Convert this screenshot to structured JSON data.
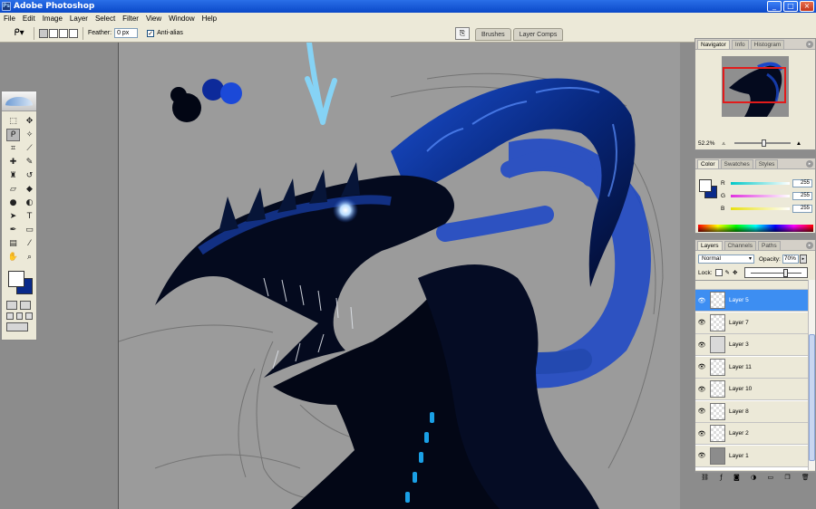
{
  "app": {
    "title": "Adobe Photoshop",
    "window_buttons": [
      "_",
      "□",
      "×"
    ]
  },
  "menu": [
    "File",
    "Edit",
    "Image",
    "Layer",
    "Select",
    "Filter",
    "View",
    "Window",
    "Help"
  ],
  "options": {
    "feather_label": "Feather:",
    "feather_value": "0 px",
    "antialias_label": "Anti-alias",
    "antialias_checked": "✓"
  },
  "palette_well": [
    "Brushes",
    "Layer Comps"
  ],
  "navigator": {
    "tabs": [
      "Navigator",
      "Info",
      "Histogram"
    ],
    "zoom": "52.2%"
  },
  "color": {
    "tabs": [
      "Color",
      "Swatches",
      "Styles"
    ],
    "sliders": [
      {
        "label": "R",
        "value": "255",
        "color": "#00c8c8"
      },
      {
        "label": "G",
        "value": "255",
        "color": "#e030e0"
      },
      {
        "label": "B",
        "value": "255",
        "color": "#e8e010"
      }
    ]
  },
  "layers": {
    "tabs": [
      "Layers",
      "Channels",
      "Paths"
    ],
    "blend_mode": "Normal",
    "opacity_label": "Opacity:",
    "opacity_value": "70%",
    "opacity_fraction": 0.7,
    "lock_label": "Lock:",
    "items": [
      {
        "name": "Layer 5",
        "active": true,
        "visible": true,
        "thumb": "transparent"
      },
      {
        "name": "Layer 7",
        "active": false,
        "visible": true,
        "thumb": "transparent"
      },
      {
        "name": "Layer 3",
        "active": false,
        "visible": true,
        "thumb": "dark"
      },
      {
        "name": "Layer 11",
        "active": false,
        "visible": true,
        "thumb": "transparent"
      },
      {
        "name": "Layer 10",
        "active": false,
        "visible": true,
        "thumb": "transparent"
      },
      {
        "name": "Layer 8",
        "active": false,
        "visible": true,
        "thumb": "transparent"
      },
      {
        "name": "Layer 2",
        "active": false,
        "visible": true,
        "thumb": "transparent"
      },
      {
        "name": "Layer 1",
        "active": false,
        "visible": true,
        "thumb": "gray"
      }
    ]
  },
  "tools": {
    "foreground_color": "#ffffff",
    "background_color": "#0a2a8a"
  },
  "colors": {
    "canvas_bg": "#9b9b9b",
    "dragon_dark": "#020614",
    "dragon_blue": "#0d3cae",
    "accent_blue": "#3d8ef2",
    "arrow_cyan": "#86d3f5"
  }
}
